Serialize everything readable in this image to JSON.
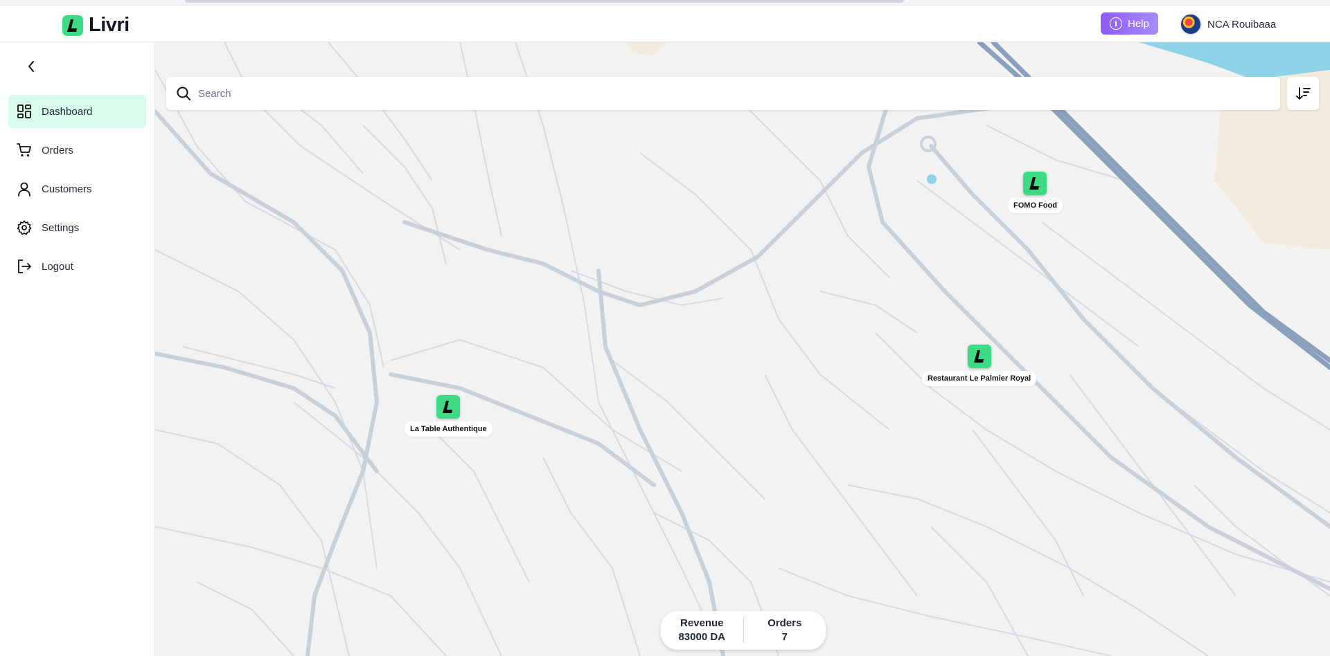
{
  "app": {
    "name": "Livri"
  },
  "header": {
    "help_label": "Help",
    "account_name": "NCA Rouibaaa"
  },
  "sidebar": {
    "items": [
      {
        "label": "Dashboard",
        "icon": "dashboard-icon",
        "active": true
      },
      {
        "label": "Orders",
        "icon": "cart-icon",
        "active": false
      },
      {
        "label": "Customers",
        "icon": "user-icon",
        "active": false
      },
      {
        "label": "Settings",
        "icon": "gear-icon",
        "active": false
      },
      {
        "label": "Logout",
        "icon": "logout-icon",
        "active": false
      }
    ]
  },
  "search": {
    "placeholder": "Search"
  },
  "map": {
    "markers": [
      {
        "label": "FOMO Food"
      },
      {
        "label": "Restaurant Le Palmier Royal"
      },
      {
        "label": "La Table Authentique"
      }
    ]
  },
  "stats": {
    "revenue_label": "Revenue",
    "revenue_value": "83000 DA",
    "orders_label": "Orders",
    "orders_value": "7"
  },
  "colors": {
    "brand_green": "#3ddc84",
    "active_nav_bg": "#d9fbe9",
    "help_purple": "#8b5cf6",
    "map_bg": "#f2f2f3",
    "road": "#d5dbe1",
    "highway": "#8aa0bd",
    "water": "#8fd3e8"
  }
}
